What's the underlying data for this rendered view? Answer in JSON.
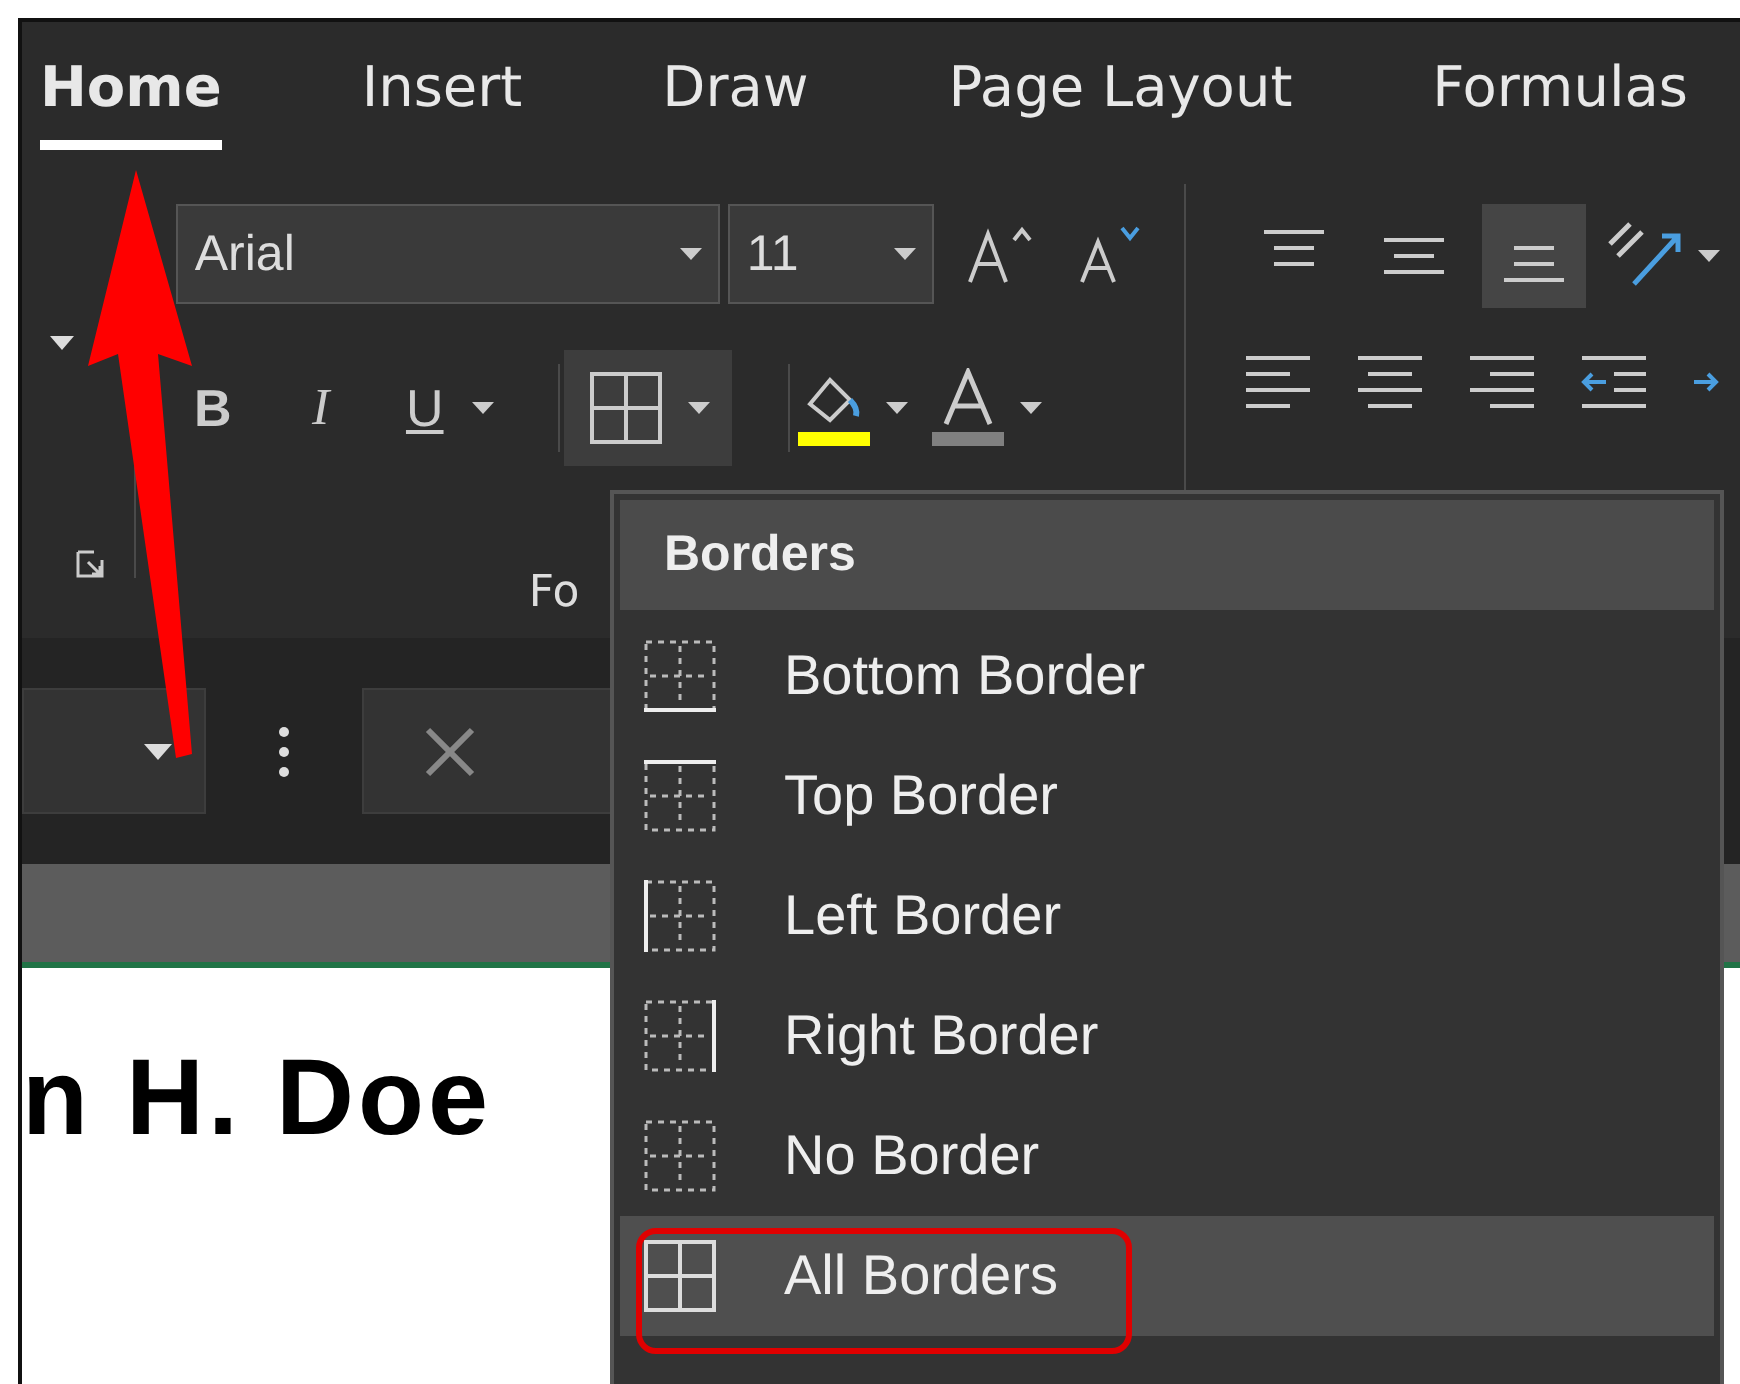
{
  "tabs": [
    {
      "label": "Home",
      "selected": true
    },
    {
      "label": "Insert",
      "selected": false
    },
    {
      "label": "Draw",
      "selected": false
    },
    {
      "label": "Page Layout",
      "selected": false
    },
    {
      "label": "Formulas",
      "selected": false
    }
  ],
  "font_group": {
    "font_name": "Arial",
    "font_size": "11",
    "format_buttons": [
      {
        "label": "B"
      },
      {
        "label": "I"
      },
      {
        "label": "U"
      }
    ],
    "group_label": "Fo"
  },
  "alignment_group": {
    "vertical_align": [
      {
        "selected": false
      },
      {
        "selected": false
      },
      {
        "selected": true
      }
    ]
  },
  "borders_menu": {
    "title": "Borders",
    "items": [
      {
        "label": "Bottom Border",
        "selected": false
      },
      {
        "label": "Top Border",
        "selected": false
      },
      {
        "label": "Left Border",
        "selected": false
      },
      {
        "label": "Right Border",
        "selected": false
      },
      {
        "label": "No Border",
        "selected": false
      },
      {
        "label": "All Borders",
        "selected": true
      }
    ]
  },
  "sheet": {
    "cell_text": "n H. Doe"
  }
}
